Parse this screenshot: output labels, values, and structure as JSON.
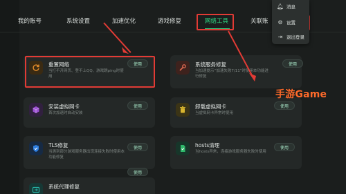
{
  "nav": {
    "items": [
      {
        "label": "我的账号"
      },
      {
        "label": "系统设置"
      },
      {
        "label": "加速优化"
      },
      {
        "label": "游戏修复"
      },
      {
        "label": "网络工具"
      },
      {
        "label": "关联账"
      }
    ],
    "active": "网络工具"
  },
  "menu": {
    "items": [
      {
        "label": "消息",
        "icon": "bell-icon"
      },
      {
        "label": "设置",
        "icon": "gear-icon"
      },
      {
        "label": "退出登录",
        "icon": "logout-icon"
      }
    ]
  },
  "cards": [
    {
      "title": "重置网络",
      "desc": "当打不开网页、登不上QQ、游戏跳ping时使用",
      "button": "使用",
      "icon": "reset-icon",
      "color": "#c4731f"
    },
    {
      "title": "系统服务修复",
      "desc": "当加速提示“加速失败7/11”时使用本功能进行修复",
      "button": "使用",
      "icon": "wrench-icon",
      "color": "#c0523d"
    },
    {
      "title": "安装虚拟网卡",
      "desc": "首次加速时自动安装",
      "button": "使用",
      "icon": "cube-icon",
      "color": "#9b4fd1"
    },
    {
      "title": "卸载虚拟网卡",
      "desc": "当虚拟网卡异常时使用",
      "button": "使用",
      "icon": "trash-icon",
      "color": "#c8a62a"
    },
    {
      "title": "TLS修复",
      "desc": "当遇到部分游戏服务器出现连接失败时使用本功能修复",
      "button": "使用",
      "icon": "shield-icon",
      "color": "#2f7fe0"
    },
    {
      "title": "hosts清理",
      "desc": "当hosts异常，连接游戏服务器失败时使用",
      "button": "使用",
      "icon": "file-icon",
      "color": "#2fb86a"
    },
    {
      "title": "系统代理修复",
      "desc": "",
      "button": "使用",
      "icon": "proxy-icon",
      "color": "#27b3a6"
    }
  ],
  "watermark": "手游Game",
  "colors": {
    "accent": "#2fd884",
    "annotation": "#e23b35",
    "watermark": "#ff6a2a"
  }
}
